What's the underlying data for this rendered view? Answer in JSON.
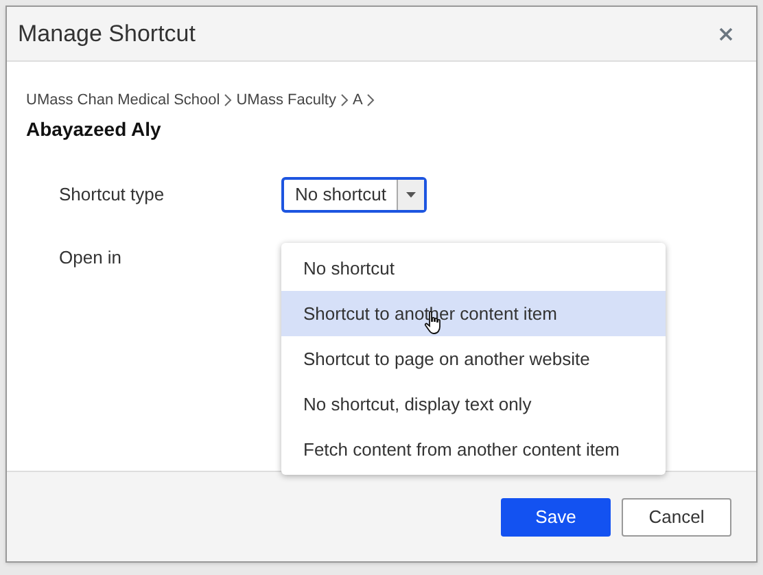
{
  "dialog": {
    "title": "Manage Shortcut"
  },
  "breadcrumb": [
    "UMass Chan Medical School",
    "UMass Faculty",
    "A"
  ],
  "item_title": "Abayazeed Aly",
  "fields": [
    {
      "label": "Shortcut type",
      "kind": "select",
      "value": "No shortcut",
      "expanded": true
    },
    {
      "label": "Open in",
      "kind": "plain"
    }
  ],
  "options": [
    {
      "label": "No shortcut",
      "highlighted": false
    },
    {
      "label": "Shortcut to another content item",
      "highlighted": true
    },
    {
      "label": "Shortcut to page on another website",
      "highlighted": false
    },
    {
      "label": "No shortcut, display text only",
      "highlighted": false
    },
    {
      "label": "Fetch content from another content item",
      "highlighted": false
    }
  ],
  "buttons": [
    {
      "label": "Save",
      "kind": "primary"
    },
    {
      "label": "Cancel",
      "kind": "secondary"
    }
  ]
}
